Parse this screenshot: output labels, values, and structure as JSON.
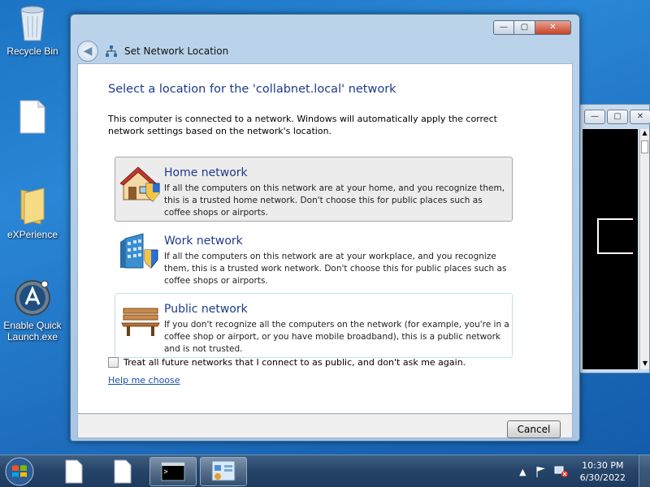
{
  "desktop": {
    "icons": [
      {
        "label": "Recycle Bin",
        "icon": "recycle-bin-icon"
      },
      {
        "label": "",
        "icon": "blank-file-icon"
      },
      {
        "label": "eXPerience",
        "icon": "folder-icon"
      },
      {
        "label": "Enable Quick Launch.exe",
        "icon": "quick-launch-app-icon"
      }
    ]
  },
  "dialog": {
    "nav_title": "Set Network Location",
    "heading": "Select a location for the 'collabnet.local' network",
    "intro": "This computer is connected to a network. Windows will automatically apply the correct network settings based on the network's location.",
    "options": [
      {
        "title": "Home network",
        "description": "If all the computers on this network are at your home, and you recognize them, this is a trusted home network.  Don't choose this for public places such as coffee shops or airports.",
        "icon": "home-network-icon",
        "state": "selected"
      },
      {
        "title": "Work network",
        "description": "If all the computers on this network are at your workplace, and you recognize them, this is a trusted work network.  Don't choose this for public places such as coffee shops or airports.",
        "icon": "work-network-icon",
        "state": "normal"
      },
      {
        "title": "Public network",
        "description": "If you don't recognize all the computers on the network (for example, you're in a coffee shop or airport, or you have mobile broadband), this is a public network and is not trusted.",
        "icon": "public-network-bench-icon",
        "state": "hovered"
      }
    ],
    "checkbox_label": "Treat all future networks that I connect to as public, and don't ask me again.",
    "checkbox_checked": false,
    "help_link": "Help me choose",
    "cancel_label": "Cancel"
  },
  "taskbar": {
    "items": [
      {
        "icon": "file-icon",
        "active": false
      },
      {
        "icon": "file-icon",
        "active": false
      },
      {
        "icon": "command-prompt-icon",
        "active": true
      },
      {
        "icon": "network-dialog-icon",
        "active": true
      }
    ],
    "clock_time": "10:30 PM",
    "clock_date": "6/30/2022"
  },
  "colors": {
    "desktop_bg": "#1f6fbf",
    "heading": "#1e3a8a",
    "link": "#1a4fa8",
    "close_button": "#c7432a"
  }
}
